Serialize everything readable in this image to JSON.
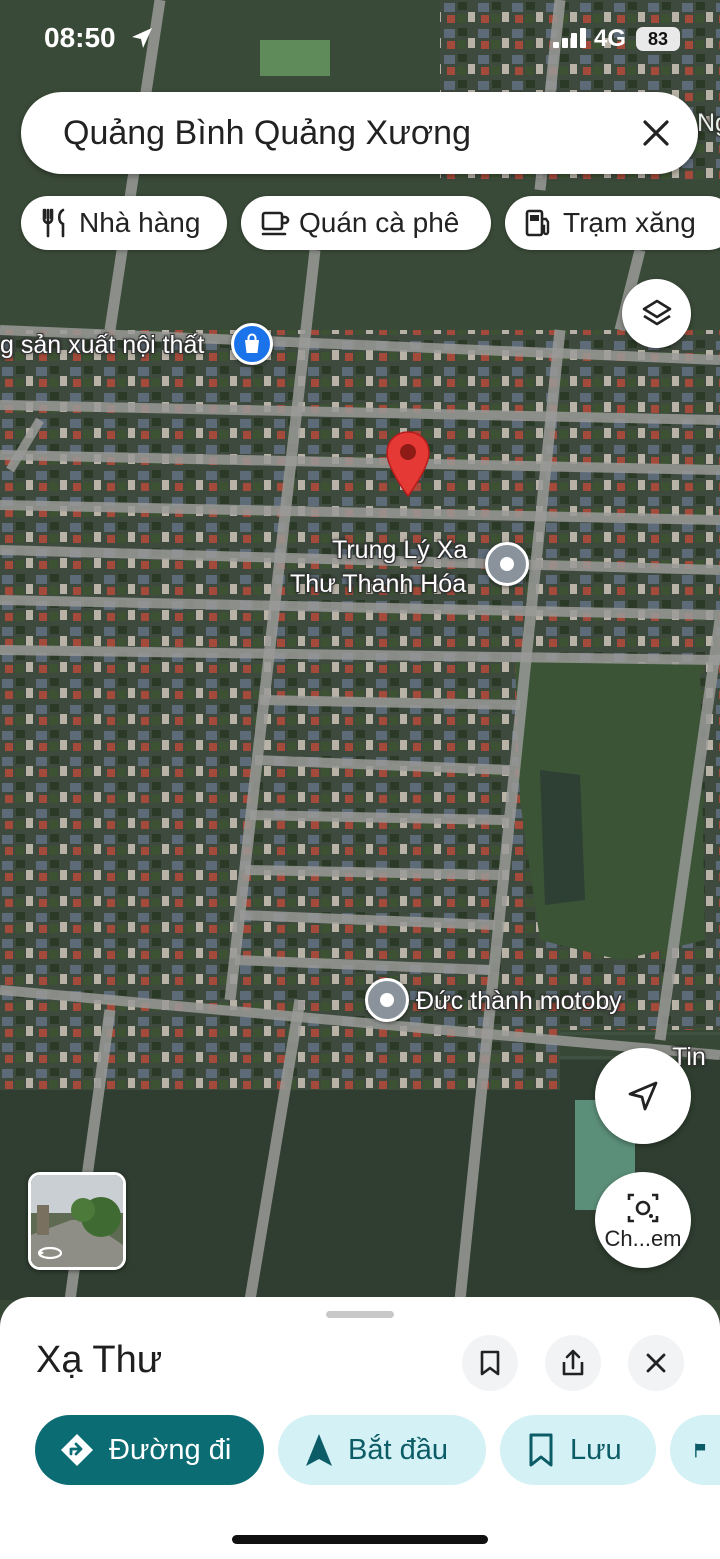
{
  "status_bar": {
    "time": "08:50",
    "network": "4G",
    "battery": "83"
  },
  "search": {
    "query": "Quảng Bình Quảng Xương"
  },
  "chips": [
    {
      "label": "Nhà hàng",
      "icon": "fork-knife-icon"
    },
    {
      "label": "Quán cà phê",
      "icon": "coffee-cup-icon"
    },
    {
      "label": "Trạm xăng",
      "icon": "gas-station-icon"
    }
  ],
  "map": {
    "labels": {
      "furniture": "g sản xuất nội thất",
      "trung_ly_line1": "Trung Lý Xa",
      "trung_ly_line2": "Thư Thanh Hóa",
      "motoby": "Đức thành motoby",
      "ngh_partial": "Ngh",
      "tin_partial": "Tin"
    },
    "pin_color": "#e53935"
  },
  "camera_button": {
    "label": "Ch...em"
  },
  "place": {
    "name": "Xạ Thư"
  },
  "actions": [
    {
      "label": "Đường đi",
      "icon": "directions-icon"
    },
    {
      "label": "Bắt đầu",
      "icon": "navigation-arrow-icon"
    },
    {
      "label": "Lưu",
      "icon": "bookmark-icon"
    }
  ],
  "colors": {
    "primary": "#0b6c73",
    "secondary": "#d4f1f6",
    "poi_shop": "#1a73e8"
  }
}
